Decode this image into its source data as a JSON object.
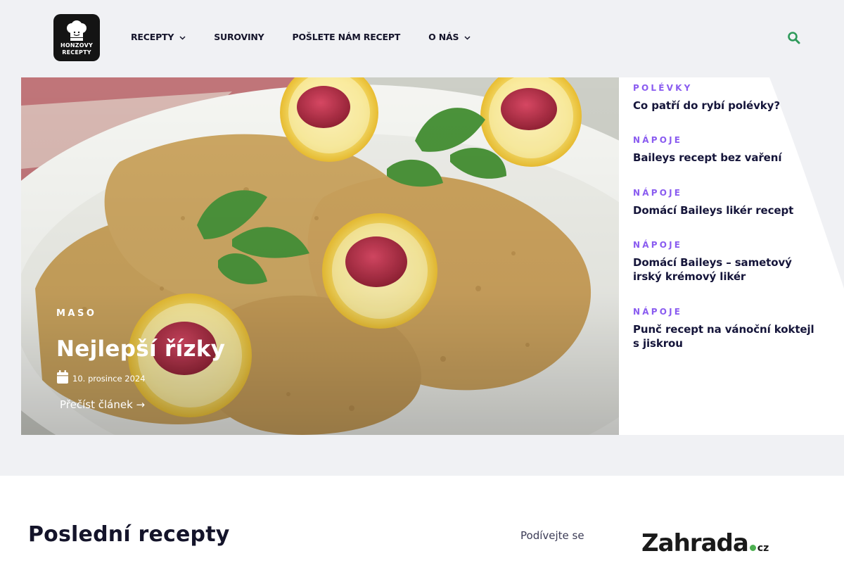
{
  "header": {
    "logo_text": [
      "HONZOVY",
      "RECEPTY"
    ],
    "nav": [
      {
        "label": "RECEPTY",
        "has_dropdown": true
      },
      {
        "label": "SUROVINY",
        "has_dropdown": false
      },
      {
        "label": "POŠLETE NÁM RECEPT",
        "has_dropdown": false
      },
      {
        "label": "O NÁS",
        "has_dropdown": true
      }
    ],
    "search_icon": "search-icon",
    "accent_color": "#2e9a5a"
  },
  "hero": {
    "category": "MASO",
    "title": "Nejlepší řízky",
    "date": "10. prosince 2024",
    "read_more": "Přečíst článek →"
  },
  "side_posts": [
    {
      "category": "POLÉVKY",
      "title": "Co patří do rybí polévky?"
    },
    {
      "category": "NÁPOJE",
      "title": "Baileys recept bez vaření"
    },
    {
      "category": "NÁPOJE",
      "title": "Domácí Baileys likér recept"
    },
    {
      "category": "NÁPOJE",
      "title": "Domácí Baileys – sametový irský krémový likér"
    },
    {
      "category": "NÁPOJE",
      "title": "Punč recept na vánoční koktejl s jiskrou"
    }
  ],
  "latest": {
    "title": "Poslední recepty",
    "look_link": "Podívejte se"
  },
  "partner": {
    "name": "Zahrada",
    "tld": "cz"
  },
  "colors": {
    "category_purple": "#8a5cf0",
    "page_bg": "#f0f1f4"
  }
}
